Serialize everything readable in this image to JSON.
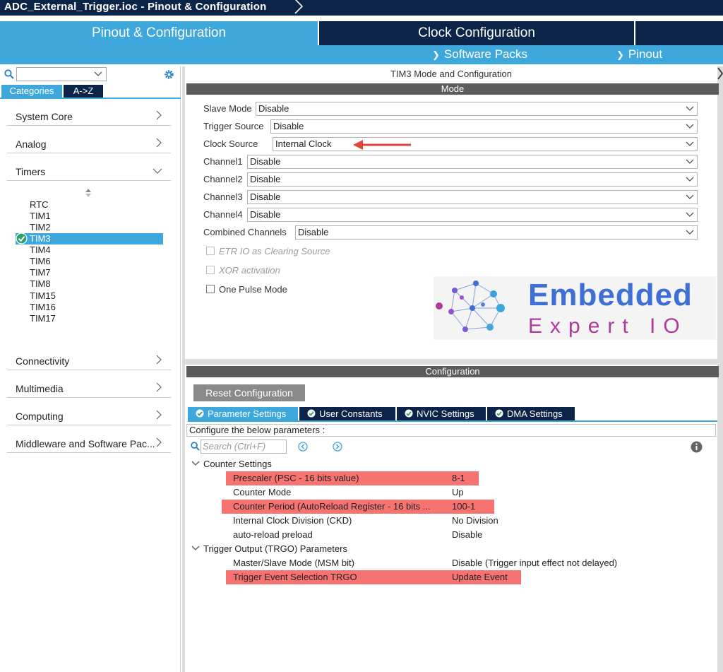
{
  "window": {
    "title": "ADC_External_Trigger.ioc - Pinout & Configuration"
  },
  "main_tabs": {
    "pinout": "Pinout & Configuration",
    "clock": "Clock Configuration"
  },
  "sub_tabs": {
    "software_packs": "Software Packs",
    "pinout": "Pinout"
  },
  "left": {
    "tabs": {
      "categories": "Categories",
      "az": "A->Z"
    },
    "categories": [
      "System Core",
      "Analog",
      "Timers",
      "Connectivity",
      "Multimedia",
      "Computing",
      "Middleware and Software Pac..."
    ],
    "timers": [
      "RTC",
      "TIM1",
      "TIM2",
      "TIM3",
      "TIM4",
      "TIM6",
      "TIM7",
      "TIM8",
      "TIM15",
      "TIM16",
      "TIM17"
    ],
    "selected_timer": "TIM3"
  },
  "mode": {
    "panel_title": "TIM3 Mode and Configuration",
    "section": "Mode",
    "fields": [
      {
        "label": "Slave Mode",
        "value": "Disable"
      },
      {
        "label": "Trigger Source",
        "value": "Disable"
      },
      {
        "label": "Clock Source",
        "value": "Internal Clock"
      },
      {
        "label": "Channel1",
        "value": "Disable"
      },
      {
        "label": "Channel2",
        "value": "Disable"
      },
      {
        "label": "Channel3",
        "value": "Disable"
      },
      {
        "label": "Channel4",
        "value": "Disable"
      },
      {
        "label": "Combined Channels",
        "value": "Disable"
      }
    ],
    "checkboxes": [
      {
        "label": "ETR IO as Clearing Source",
        "enabled": false,
        "checked": false
      },
      {
        "label": "XOR activation",
        "enabled": false,
        "checked": false
      },
      {
        "label": "One Pulse Mode",
        "enabled": true,
        "checked": false
      }
    ]
  },
  "logo": {
    "line1": "Embedded",
    "line2": "Expert IO"
  },
  "configuration": {
    "section": "Configuration",
    "reset_button": "Reset Configuration",
    "tabs": [
      "Parameter Settings",
      "User Constants",
      "NVIC Settings",
      "DMA Settings"
    ],
    "active_tab": "Parameter Settings",
    "info": "Configure the below parameters :",
    "search_placeholder": "Search (Ctrl+F)",
    "groups": [
      {
        "name": "Counter Settings",
        "params": [
          {
            "name": "Prescaler (PSC - 16 bits value)",
            "value": "8-1",
            "highlight": true
          },
          {
            "name": "Counter Mode",
            "value": "Up",
            "highlight": false
          },
          {
            "name": "Counter Period (AutoReload Register - 16 bits ...",
            "value": "100-1",
            "highlight": true
          },
          {
            "name": "Internal Clock Division (CKD)",
            "value": "No Division",
            "highlight": false
          },
          {
            "name": "auto-reload preload",
            "value": "Disable",
            "highlight": false
          }
        ]
      },
      {
        "name": "Trigger Output (TRGO) Parameters",
        "params": [
          {
            "name": "Master/Slave Mode (MSM bit)",
            "value": "Disable (Trigger input effect not delayed)",
            "highlight": false
          },
          {
            "name": "Trigger Event Selection TRGO",
            "value": "Update Event",
            "highlight": true
          }
        ]
      }
    ]
  },
  "colors": {
    "navy": "#0c2447",
    "blue": "#3ea7db",
    "highlight": "#f77371",
    "bar": "#5b5b5b",
    "annotation_arrow": "#e0443a"
  }
}
